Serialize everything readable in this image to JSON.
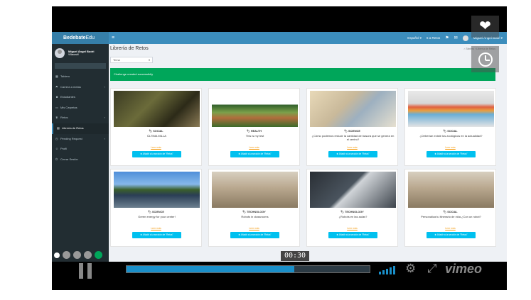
{
  "app": {
    "brand_bold": "Bedebate",
    "brand_light": "Edu"
  },
  "topnav": {
    "language": "Español ▾",
    "notifications": "6 a Retos",
    "user_name": "Miguel Ángel Bodri ▾"
  },
  "sidebar": {
    "user_name": "Miguel Ángel Bodri",
    "user_status": "Villacastil",
    "items": [
      {
        "label": "Tablero",
        "icon": "dashboard-icon",
        "arrow": ""
      },
      {
        "label": "Carrera a metas",
        "icon": "flag-icon",
        "arrow": "‹"
      },
      {
        "label": "Estudiantes",
        "icon": "users-icon",
        "arrow": ""
      },
      {
        "label": "Mis Carpetas",
        "icon": "folder-icon",
        "arrow": ""
      },
      {
        "label": "Retos",
        "icon": "trophy-icon",
        "arrow": "‹"
      },
      {
        "label": "Librería de Retos",
        "icon": "book-icon",
        "arrow": "",
        "active": true
      },
      {
        "label": "Pending Request",
        "icon": "clock-icon",
        "arrow": "‹"
      },
      {
        "label": "Profil",
        "icon": "user-icon",
        "arrow": ""
      },
      {
        "label": "Cerrar Sesión",
        "icon": "logout-icon",
        "arrow": ""
      }
    ]
  },
  "main": {
    "title": "Librería de Retos",
    "breadcrumb": "⌂ Tablero › Librería de Retos",
    "select_value": "Tema",
    "alert": "Challenge created successfully",
    "cards": [
      {
        "category": "SOCIAL",
        "title": "ÚLTIMA MILLA",
        "link": "Leer más",
        "button": "✚ Añadir a la sección de \"Retos\""
      },
      {
        "category": "HEALTH",
        "title": "This is my test",
        "link": "Leer más",
        "button": "✚ Añadir a la sección de \"Retos\""
      },
      {
        "category": "SCIENCE",
        "title": "¿Cómo podemos reducir la cantidad de basura que se genera en el centro?",
        "link": "Leer más",
        "button": "✚ Añadir a la sección de \"Retos\""
      },
      {
        "category": "SOCIAL",
        "title": "¿Deberían existir los zoológicos en la actualidad?",
        "link": "Leer más",
        "button": "✚ Añadir a la sección de \"Retos\""
      },
      {
        "category": "SCIENCE",
        "title": "Green energy for your center!",
        "link": "Leer más",
        "button": "✚ Añadir a la sección de \"Retos\""
      },
      {
        "category": "TECHNOLOGY",
        "title": "Robots in classrooms",
        "link": "Leer más",
        "button": "✚ Añadir a la sección de \"Retos\""
      },
      {
        "category": "TECHNOLOGY",
        "title": "¿Robots en las aulas?",
        "link": "Leer más",
        "button": "✚ Añadir a la sección de \"Retos\""
      },
      {
        "category": "SOCIAL",
        "title": "Personaliza tu itinerario de vida ¿Con un robot?",
        "link": "Leer más",
        "button": "✚ Añadir a la sección de \"Retos\""
      }
    ]
  },
  "player": {
    "time": "00:30",
    "progress": 0.69,
    "brand": "vimeo",
    "icons": [
      "heart-icon",
      "watch-later-icon",
      "pause-icon",
      "volume-icon",
      "settings-icon",
      "fullscreen-icon",
      "vimeo-logo"
    ]
  },
  "colors": {
    "accent": "#3c8dbc",
    "sidebar": "#222d32",
    "success": "#00a65a",
    "button": "#00c0ef",
    "link": "#f39c12",
    "progress": "#1a8fc9"
  }
}
